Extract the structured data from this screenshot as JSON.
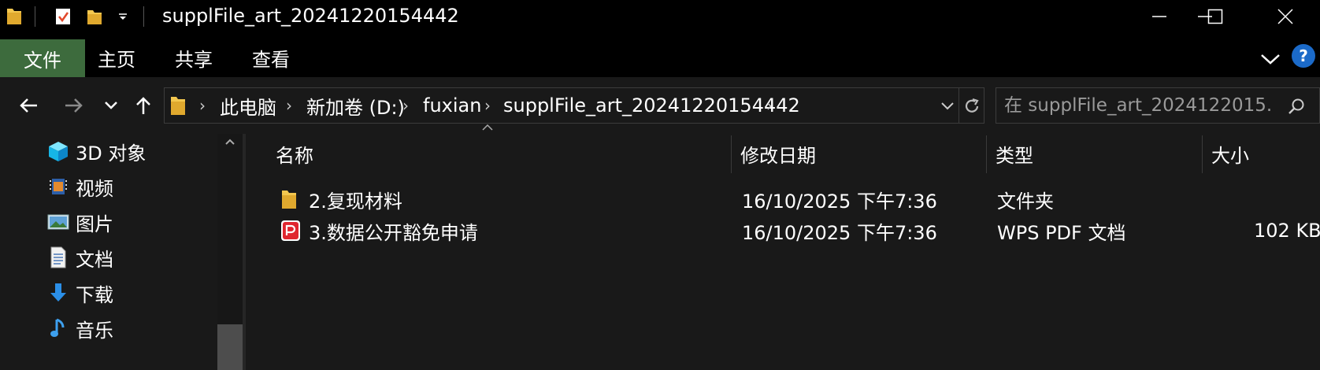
{
  "window": {
    "title": "supplFile_art_20241220154442",
    "controls": {
      "minimize": "minimize",
      "maximize": "maximize",
      "close": "close"
    }
  },
  "quick_access": {
    "icons": [
      "folder-icon",
      "properties-icon",
      "new-folder-icon",
      "customize-dropdown-icon"
    ]
  },
  "ribbon": {
    "tabs": [
      {
        "label": "文件",
        "active": true
      },
      {
        "label": "主页"
      },
      {
        "label": "共享"
      },
      {
        "label": "查看"
      }
    ],
    "expand_icon": "chevron-down-icon",
    "help_icon": "help-icon"
  },
  "nav": {
    "breadcrumb": [
      {
        "label": "此电脑"
      },
      {
        "label": "新加卷 (D:)"
      },
      {
        "label": "fuxian"
      },
      {
        "label": "supplFile_art_20241220154442"
      }
    ],
    "search_placeholder": "在 supplFile_art_2024122015..."
  },
  "sidebar": {
    "items": [
      {
        "label": "3D 对象",
        "icon": "3d-objects-icon"
      },
      {
        "label": "视频",
        "icon": "video-icon"
      },
      {
        "label": "图片",
        "icon": "pictures-icon"
      },
      {
        "label": "文档",
        "icon": "documents-icon"
      },
      {
        "label": "下载",
        "icon": "download-icon"
      },
      {
        "label": "音乐",
        "icon": "music-icon"
      }
    ]
  },
  "files": {
    "columns": {
      "name": "名称",
      "modified": "修改日期",
      "type": "类型",
      "size": "大小"
    },
    "rows": [
      {
        "name": "2.复现材料",
        "modified": "16/10/2025 下午7:36",
        "type": "文件夹",
        "size": "",
        "icon": "folder-icon"
      },
      {
        "name": "3.数据公开豁免申请",
        "modified": "16/10/2025 下午7:36",
        "type": "WPS PDF 文档",
        "size": "102 KB",
        "icon": "pdf-icon"
      }
    ]
  },
  "colors": {
    "accent_file_tab": "#3d6b3d",
    "folder": "#f3c74f",
    "pdf": "#e0262f",
    "help": "#1b6ac9"
  }
}
